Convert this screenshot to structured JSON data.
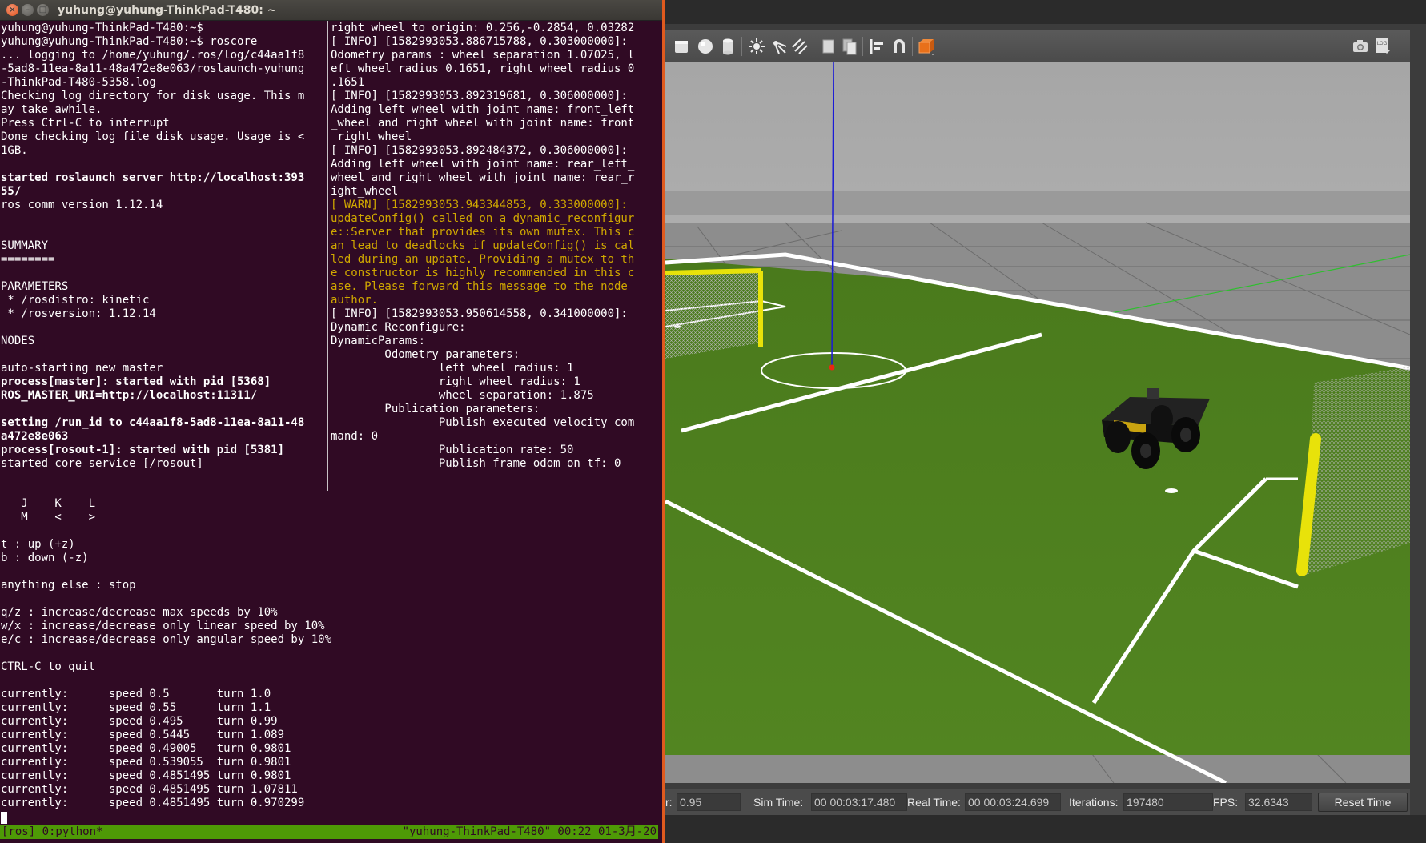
{
  "terminal": {
    "title": "yuhung@yuhung-ThinkPad-T480: ~",
    "roscore_lines": [
      {
        "t": "yuhung@yuhung-ThinkPad-T480:~$"
      },
      {
        "t": "yuhung@yuhung-ThinkPad-T480:~$ roscore"
      },
      {
        "t": "... logging to /home/yuhung/.ros/log/c44aa1f8"
      },
      {
        "t": "-5ad8-11ea-8a11-48a472e8e063/roslaunch-yuhung"
      },
      {
        "t": "-ThinkPad-T480-5358.log"
      },
      {
        "t": "Checking log directory for disk usage. This m"
      },
      {
        "t": "ay take awhile."
      },
      {
        "t": "Press Ctrl-C to interrupt"
      },
      {
        "t": "Done checking log file disk usage. Usage is <"
      },
      {
        "t": "1GB."
      },
      {
        "t": ""
      },
      {
        "t": "started roslaunch server http://localhost:393",
        "b": true
      },
      {
        "t": "55/",
        "b": true
      },
      {
        "t": "ros_comm version 1.12.14"
      },
      {
        "t": ""
      },
      {
        "t": ""
      },
      {
        "t": "SUMMARY"
      },
      {
        "t": "========"
      },
      {
        "t": ""
      },
      {
        "t": "PARAMETERS"
      },
      {
        "t": " * /rosdistro: kinetic"
      },
      {
        "t": " * /rosversion: 1.12.14"
      },
      {
        "t": ""
      },
      {
        "t": "NODES"
      },
      {
        "t": ""
      },
      {
        "t": "auto-starting new master"
      },
      {
        "t": "process[master]: started with pid [5368]",
        "b": true
      },
      {
        "t": "ROS_MASTER_URI=http://localhost:11311/",
        "b": true
      },
      {
        "t": ""
      },
      {
        "t": "setting /run_id to c44aa1f8-5ad8-11ea-8a11-48",
        "b": true
      },
      {
        "t": "a472e8e063",
        "b": true
      },
      {
        "t": "process[rosout-1]: started with pid [5381]",
        "b": true
      },
      {
        "t": "started core service [/rosout]"
      }
    ],
    "log_lines": [
      {
        "t": "right wheel to origin: 0.256,-0.2854, 0.03282"
      },
      {
        "t": "[ INFO] [1582993053.886715788, 0.303000000]:"
      },
      {
        "t": "Odometry params : wheel separation 1.07025, l"
      },
      {
        "t": "eft wheel radius 0.1651, right wheel radius 0"
      },
      {
        "t": ".1651"
      },
      {
        "t": "[ INFO] [1582993053.892319681, 0.306000000]:"
      },
      {
        "t": "Adding left wheel with joint name: front_left"
      },
      {
        "t": "_wheel and right wheel with joint name: front"
      },
      {
        "t": "_right_wheel"
      },
      {
        "t": "[ INFO] [1582993053.892484372, 0.306000000]:"
      },
      {
        "t": "Adding left wheel with joint name: rear_left_"
      },
      {
        "t": "wheel and right wheel with joint name: rear_r"
      },
      {
        "t": "ight_wheel"
      },
      {
        "t": "[ WARN] [1582993053.943344853, 0.333000000]:",
        "w": true
      },
      {
        "t": "updateConfig() called on a dynamic_reconfigur",
        "w": true
      },
      {
        "t": "e::Server that provides its own mutex. This c",
        "w": true
      },
      {
        "t": "an lead to deadlocks if updateConfig() is cal",
        "w": true
      },
      {
        "t": "led during an update. Providing a mutex to th",
        "w": true
      },
      {
        "t": "e constructor is highly recommended in this c",
        "w": true
      },
      {
        "t": "ase. Please forward this message to the node",
        "w": true
      },
      {
        "t": "author.",
        "w": true
      },
      {
        "t": "[ INFO] [1582993053.950614558, 0.341000000]:"
      },
      {
        "t": "Dynamic Reconfigure:"
      },
      {
        "t": "DynamicParams:"
      },
      {
        "t": "        Odometry parameters:"
      },
      {
        "t": "                left wheel radius: 1"
      },
      {
        "t": "                right wheel radius: 1"
      },
      {
        "t": "                wheel separation: 1.875"
      },
      {
        "t": "        Publication parameters:"
      },
      {
        "t": "                Publish executed velocity com"
      },
      {
        "t": "mand: 0"
      },
      {
        "t": "                Publication rate: 50"
      },
      {
        "t": "                Publish frame odom on tf: 0"
      }
    ],
    "teleop_lines": [
      {
        "t": "   J    K    L"
      },
      {
        "t": "   M    <    >"
      },
      {
        "t": ""
      },
      {
        "t": "t : up (+z)"
      },
      {
        "t": "b : down (-z)"
      },
      {
        "t": ""
      },
      {
        "t": "anything else : stop"
      },
      {
        "t": ""
      },
      {
        "t": "q/z : increase/decrease max speeds by 10%"
      },
      {
        "t": "w/x : increase/decrease only linear speed by 10%"
      },
      {
        "t": "e/c : increase/decrease only angular speed by 10%"
      },
      {
        "t": ""
      },
      {
        "t": "CTRL-C to quit"
      },
      {
        "t": ""
      },
      {
        "t": "currently:      speed 0.5       turn 1.0"
      },
      {
        "t": "currently:      speed 0.55      turn 1.1"
      },
      {
        "t": "currently:      speed 0.495     turn 0.99"
      },
      {
        "t": "currently:      speed 0.5445    turn 1.089"
      },
      {
        "t": "currently:      speed 0.49005   turn 0.9801"
      },
      {
        "t": "currently:      speed 0.539055  turn 0.9801"
      },
      {
        "t": "currently:      speed 0.4851495 turn 0.9801"
      },
      {
        "t": "currently:      speed 0.4851495 turn 1.07811"
      },
      {
        "t": "currently:      speed 0.4851495 turn 0.970299"
      }
    ],
    "tmux_left": "[ros] 0:python*",
    "tmux_right": "\"yuhung-ThinkPad-T480\" 00:22 01-3月-20"
  },
  "gazebo": {
    "toolbar_icons": [
      "box-shape-icon",
      "sphere-shape-icon",
      "cylinder-shape-icon",
      "point-light-icon",
      "spot-light-icon",
      "directional-light-icon",
      "copy-icon",
      "paste-icon",
      "align-icon",
      "snap-icon",
      "change-view-icon",
      "screenshot-icon",
      "log-icon"
    ],
    "status": {
      "rtf_label": "r:",
      "rtf_value": "0.95",
      "sim_time_label": "Sim Time:",
      "sim_time_value": "00 00:03:17.480",
      "real_time_label": "Real Time:",
      "real_time_value": "00 00:03:24.699",
      "iterations_label": "Iterations:",
      "iterations_value": "197480",
      "fps_label": "FPS:",
      "fps_value": "32.6343",
      "reset_label": "Reset Time"
    },
    "colors": {
      "field": "#4f7f1f",
      "goal": "#e8e20a",
      "robot": "#1c1c1c",
      "sky": "#b5b5b5",
      "ground": "#8a8a8a"
    }
  }
}
